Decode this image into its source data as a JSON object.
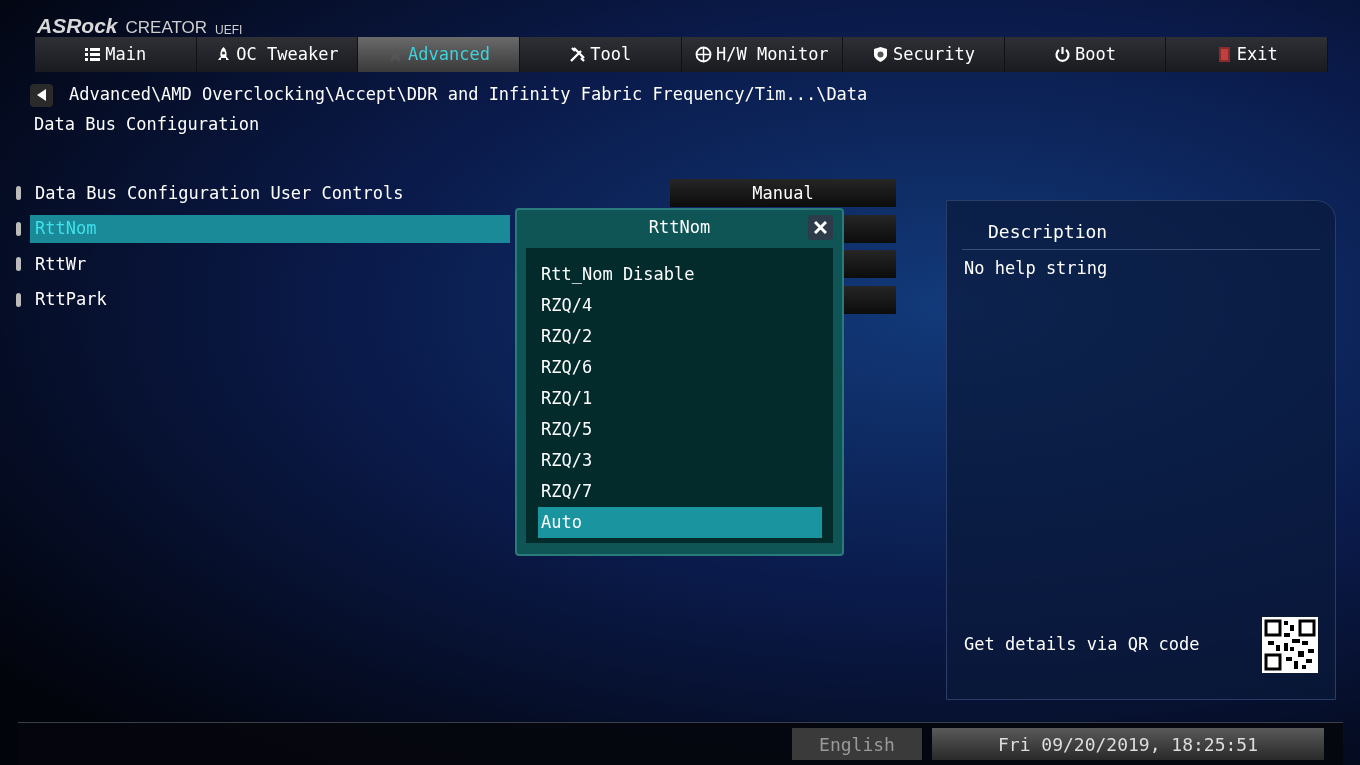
{
  "brand": {
    "logo": "ASRock",
    "edition": "CREATOR",
    "tag": "UEFI"
  },
  "tabs": [
    {
      "label": "Main",
      "selected": false
    },
    {
      "label": "OC Tweaker",
      "selected": false
    },
    {
      "label": "Advanced",
      "selected": true
    },
    {
      "label": "Tool",
      "selected": false
    },
    {
      "label": "H/W Monitor",
      "selected": false
    },
    {
      "label": "Security",
      "selected": false
    },
    {
      "label": "Boot",
      "selected": false
    },
    {
      "label": "Exit",
      "selected": false
    }
  ],
  "breadcrumb": "Advanced\\AMD Overclocking\\Accept\\DDR and Infinity Fabric Frequency/Tim...\\Data",
  "page_title": "Data Bus Configuration",
  "settings": [
    {
      "label": "Data Bus Configuration User Controls",
      "value": "Manual",
      "selected": false
    },
    {
      "label": "RttNom",
      "selected": true
    },
    {
      "label": "RttWr",
      "selected": false
    },
    {
      "label": "RttPark",
      "selected": false
    }
  ],
  "popup": {
    "title": "RttNom",
    "options": [
      {
        "label": "Rtt_Nom Disable",
        "selected": false
      },
      {
        "label": "RZQ/4",
        "selected": false
      },
      {
        "label": "RZQ/2",
        "selected": false
      },
      {
        "label": "RZQ/6",
        "selected": false
      },
      {
        "label": "RZQ/1",
        "selected": false
      },
      {
        "label": "RZQ/5",
        "selected": false
      },
      {
        "label": "RZQ/3",
        "selected": false
      },
      {
        "label": "RZQ/7",
        "selected": false
      },
      {
        "label": "Auto",
        "selected": true
      }
    ]
  },
  "description": {
    "title": "Description",
    "text": "No help string",
    "qr_hint": "Get details via QR code"
  },
  "status_bar": {
    "language": "English",
    "datetime": "Fri 09/20/2019, 18:25:51"
  }
}
